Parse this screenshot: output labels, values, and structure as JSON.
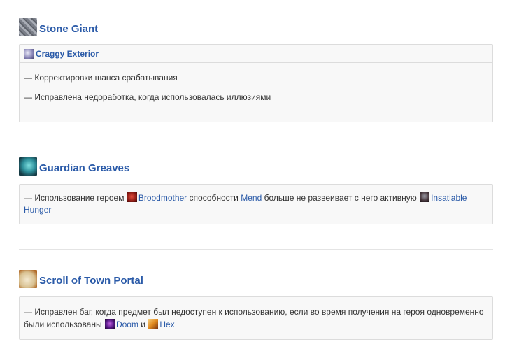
{
  "sections": [
    {
      "title": "Stone Giant",
      "icon": "stone-giant-icon",
      "subtitle": "Craggy Exterior",
      "subicon": "craggy-exterior-icon",
      "lines": [
        "— Корректировки шанса срабатывания",
        "— Исправлена недоработка, когда использовалась иллюзиями"
      ]
    },
    {
      "title": "Guardian Greaves",
      "icon": "guardian-greaves-icon",
      "line": {
        "t1": "— Использование героем ",
        "hero": "Broodmother",
        "t2": " способности ",
        "ability": "Mend",
        "t3": " больше не развеивает с него активную ",
        "effect": "Insatiable Hunger"
      }
    },
    {
      "title": "Scroll of Town Portal",
      "icon": "town-portal-scroll-icon",
      "line": {
        "t1": "— Исправлен баг, когда предмет был недоступен к использованию, если во время получения на героя одновременно были использованы ",
        "link1": "Doom",
        "t2": " и ",
        "link2": "Hex"
      }
    }
  ],
  "colors": {
    "link": "#2a5aa8",
    "border": "#dcdcdc",
    "box_bg": "#f8f8f8"
  }
}
